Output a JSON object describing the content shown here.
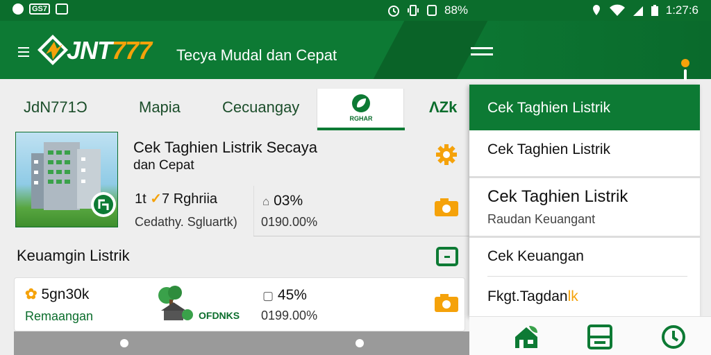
{
  "status_bar": {
    "left_chip": "GS7",
    "middle_text": "88%",
    "time": "1:27:6"
  },
  "app_bar": {
    "brand_part1": "JNT",
    "brand_part2": "777",
    "tagline": "Tecya Mudal dan Cepat"
  },
  "tabs": [
    {
      "label": "JdN771Ɔ"
    },
    {
      "label": "Mapia"
    },
    {
      "label": "Cecuangay"
    },
    {
      "label": "RGHAR",
      "active": true
    },
    {
      "label": "ɅZk"
    }
  ],
  "card1": {
    "title": "Cek Taghien Listrik Secaya",
    "subtitle": "dan Cepat",
    "row_label_prefix": "1t",
    "row_label": "7 Rghriia",
    "row_sub": "Cedathy. Sgluartk)",
    "percent": "03%",
    "value": "0190.00%"
  },
  "section_title": "Keuamgin Listrik",
  "card2": {
    "amount": "5gn30k",
    "label": "Remaangan",
    "brand": "OFDNKS",
    "percent": "45%",
    "value": "0199.00%"
  },
  "dropdown": {
    "header": "Cek Taghien Listrik",
    "items": [
      {
        "label": "Cek Taghien Listrik"
      },
      {
        "label": "Cek Taghien Listrik",
        "sub": "Raudan Keuangant"
      },
      {
        "label": "Cek Keuangan"
      },
      {
        "label_main": "Fkgt.Tagdan",
        "label_accent": "lk"
      }
    ]
  },
  "colors": {
    "primary": "#0d7a34",
    "accent": "#f5a20a"
  }
}
